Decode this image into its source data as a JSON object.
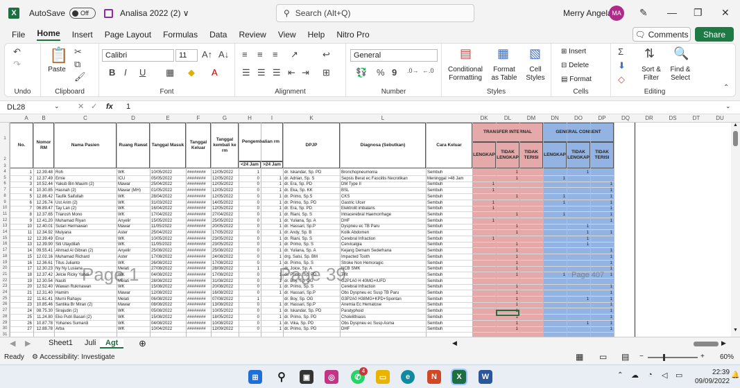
{
  "app": {
    "autosave_label": "AutoSave",
    "toggle_state": "Off",
    "doc_title": "Analisa 2022 (2)",
    "doc_suffix": "∨",
    "search_placeholder": "Search (Alt+Q)",
    "user_name": "Merry Angela",
    "user_initials": "MA"
  },
  "menu": [
    "File",
    "Home",
    "Insert",
    "Page Layout",
    "Formulas",
    "Data",
    "Review",
    "View",
    "Help",
    "Nitro Pro"
  ],
  "menu_active": "Home",
  "actions": {
    "comments": "Comments",
    "share": "Share"
  },
  "ribbon": {
    "undo_label": "Undo",
    "clipboard_label": "Clipboard",
    "paste_label": "Paste",
    "font_label": "Font",
    "font_name": "Calibri",
    "font_size": "11",
    "bold": "B",
    "italic": "I",
    "underline": "U",
    "alignment_label": "Alignment",
    "number_label": "Number",
    "number_format": "General",
    "percent": "%",
    "comma": "9",
    "conditional": "Conditional Formatting",
    "format_table": "Format as Table",
    "cell_styles": "Cell Styles",
    "styles_label": "Styles",
    "insert": "Insert",
    "delete": "Delete",
    "format": "Format",
    "cells_label": "Cells",
    "sort": "Sort & Filter",
    "find": "Find & Select",
    "editing_label": "Editing"
  },
  "formula": {
    "namebox": "DL28",
    "fx": "fx",
    "value": "1"
  },
  "columns_left": [
    "A",
    "B",
    "C",
    "D",
    "E",
    "F",
    "G",
    "H",
    "I",
    "K",
    "L"
  ],
  "columns_right": [
    "DK",
    "DL",
    "DM",
    "DN",
    "DO",
    "DP",
    "DQ",
    "DR",
    "DS",
    "DT",
    "DU"
  ],
  "row_numbers": [
    "1",
    "2",
    "3",
    "4",
    "5",
    "6",
    "7",
    "8",
    "9",
    "10",
    "11",
    "12",
    "13",
    "14",
    "15",
    "16",
    "17",
    "18",
    "19",
    "20",
    "21",
    "22",
    "23",
    "24",
    "25",
    "26",
    "27",
    "28",
    "29",
    "30",
    "31",
    "32"
  ],
  "headers": {
    "no": "No.",
    "rm": "Nomor RM",
    "nama": "Nama Pasien",
    "ruang": "Ruang Rawat",
    "masuk": "Tanggal Masuk",
    "keluar": "Tanggal Keluar",
    "kembali": "Tanggal kembali ke rm",
    "pengembalian": "Pengembalian rm",
    "lt24": "<24 Jam",
    "gt24": ">24 Jam",
    "dpjp": "DPJP",
    "diagnosa": "Diagnosa (Sebutkan)",
    "cara": "Cara Keluar",
    "transfer": "TRANSFER INTERNAL",
    "consent": "GENERAL CONSENT",
    "lengkap": "LENGKAP",
    "tidak_lengkap": "TIDAK LENGKAP",
    "tidak_terisi": "TIDAK TERISI"
  },
  "rows": [
    [
      "1",
      "12.39.48",
      "Roh",
      "WK",
      "10/05/2022",
      "########",
      "12/05/2022",
      "1",
      "",
      "dr. Iskandar, Sp. PD",
      "Bronchopneumonia",
      "Sembuh",
      "",
      "1",
      "",
      "",
      "1",
      ""
    ],
    [
      "2",
      "12.37.49",
      "Ernie",
      "ICU",
      "05/05/2022",
      "########",
      "12/05/2022",
      "0",
      "1",
      "dr. Adrian, Sp. S",
      "Sepsis Berat ec Fasciitis Necrotikan",
      "Meninggal >48 Jam",
      "",
      "1",
      "",
      "1",
      "",
      ""
    ],
    [
      "3",
      "10.52.44",
      "Yakub Bin Mauim (2)",
      "Mawar",
      "25/04/2022",
      "########",
      "12/05/2022",
      "0",
      "1",
      "dr. Era, Sp. PD",
      "DM Type II",
      "Sembuh",
      "1",
      "",
      "",
      "",
      "",
      "1"
    ],
    [
      "4",
      "10.30.85",
      "Hasnah (2)",
      "Mawar (MH)",
      "01/05/2022",
      "########",
      "12/05/2022",
      "0",
      "1",
      "dr. Eka, Sp. KK",
      "BSL",
      "Sembuh",
      "1",
      "",
      "",
      "",
      "",
      "1"
    ],
    [
      "5",
      "12.86.42",
      "Taufik Saifullah",
      "WK",
      "28/04/2022",
      "########",
      "12/05/2022",
      "0",
      "1",
      "dr. Primo, Sp.S",
      "CKS",
      "Sembuh",
      "",
      "1",
      "",
      "1",
      "",
      "1"
    ],
    [
      "6",
      "12.26.74",
      "Ust Arim (2)",
      "WK",
      "31/03/2022",
      "########",
      "14/05/2022",
      "0",
      "1",
      "dr. Primo, Sp. PD",
      "Gastric Ulcer",
      "Sembuh",
      "1",
      "",
      "",
      "1",
      "",
      "1"
    ],
    [
      "7",
      "06.89.47",
      "Tay Lan (2)",
      "WK",
      "16/04/2022",
      "########",
      "12/05/2022",
      "0",
      "1",
      "dr. Era, Sp. PD",
      "Elektrolit imbalans",
      "Sembuh",
      "1",
      "",
      "",
      "",
      "",
      "1"
    ],
    [
      "8",
      "12.37.65",
      "Triarosh Mono",
      "WK",
      "17/04/2022",
      "########",
      "27/04/2022",
      "0",
      "1",
      "dr. Riani, Sp. S",
      "Intracerebral Haemorrhage",
      "Sembuh",
      "",
      "1",
      "",
      "1",
      "",
      "1"
    ],
    [
      "9",
      "12.41.20",
      "Muhamad Riyan",
      "Anyelir",
      "15/05/2022",
      "########",
      "25/05/2022",
      "0",
      "1",
      "dr. Yuliana, Sp. A",
      "DHF",
      "Sembuh",
      "1",
      "",
      "",
      "",
      "",
      "1"
    ],
    [
      "10",
      "12.40.01",
      "Sutari Hermawan",
      "Mawar",
      "11/05/2022",
      "########",
      "20/05/2022",
      "0",
      "1",
      "dr. Hassari, Sp.P",
      "Dyspneu ec TB Paru",
      "Sembuh",
      "",
      "1",
      "",
      "",
      "1",
      ""
    ],
    [
      "11",
      "12.34.92",
      "Mulyana",
      "Aster",
      "25/04/2022",
      "########",
      "17/05/2022",
      "0",
      "1",
      "dr. Andy, Sp. B",
      "Kolik Abdomen",
      "Sembuh",
      "",
      "1",
      "",
      "",
      "1",
      "1"
    ],
    [
      "12",
      "12.39.49",
      "Enur",
      "WK",
      "10/05/2022",
      "########",
      "23/05/2022",
      "0",
      "1",
      "dr. Riani, Sp. S",
      "Cerebral Infraction",
      "Sembuh",
      "1",
      "",
      "",
      "",
      "1",
      ""
    ],
    [
      "13",
      "12.39.90",
      "Siti Utaydilah",
      "WK",
      "11/05/2022",
      "########",
      "23/05/2022",
      "0",
      "1",
      "dr. Primo, Sp. S",
      "Cervicalgia",
      "Sembuh",
      "",
      "1",
      "",
      "",
      "1",
      ""
    ],
    [
      "14",
      "09.55.41",
      "Ahmad Al Gibran (2)",
      "Anyelir",
      "25/08/2022",
      "########",
      "25/08/2022",
      "0",
      "1",
      "dr. Yuliana, Sp. A",
      "Kejang Demam Sederhana",
      "Sembuh",
      "",
      "1",
      "",
      "",
      "",
      "1"
    ],
    [
      "15",
      "12.02.16",
      "Muhamad Richard",
      "Aster",
      "17/08/2022",
      "########",
      "24/08/2022",
      "0",
      "1",
      "drg. Salsi, Sp. BM",
      "Impacted Tooth",
      "Sembuh",
      "",
      "1",
      "",
      "",
      "",
      "1"
    ],
    [
      "16",
      "12.36.61",
      "Titus Julianto",
      "WK",
      "26/08/2022",
      "########",
      "17/08/2022",
      "0",
      "1",
      "dr. Primo, Sp. S",
      "Stroke Non Hemoragic",
      "Sembuh",
      "",
      "1",
      "",
      "",
      "",
      "1"
    ],
    [
      "17",
      "12.30.23",
      "Ny Ny Lusiana",
      "Melati",
      "27/08/2022",
      "########",
      "28/08/2022",
      "1",
      "",
      "dr. Joice, Sp. A",
      "NCB SMK",
      "Sembuh",
      "",
      "1",
      "",
      "",
      "",
      "1"
    ],
    [
      "18",
      "12.37.42",
      "Jelcie Ricky Yahdi",
      "WK",
      "04/08/2022",
      "########",
      "17/08/2022",
      "0",
      "1",
      "dr. Primo, Sp. PD",
      "Tifit",
      "Sembuh",
      "",
      "1",
      "",
      "1",
      "",
      "1"
    ],
    [
      "19",
      "12.30.54",
      "Nasiti",
      "Melati",
      "28/08/2022",
      "########",
      "31/08/2022",
      "0",
      "1",
      "dr. Boy, Sp. OG",
      "G2P1A0 H 40MG+IUFD",
      "Sembuh",
      "",
      "",
      "",
      "",
      "",
      ""
    ],
    [
      "20",
      "12.52.40",
      "Wawan Rukmawan",
      "WK",
      "15/08/2022",
      "########",
      "20/08/2022",
      "0",
      "1",
      "dr. Primo, Sp. S",
      "Cerebral Infraction",
      "Sembuh",
      "",
      "1",
      "",
      "",
      "",
      "1"
    ],
    [
      "21",
      "12.31.40",
      "Hamim",
      "Mawar",
      "12/08/2022",
      "########",
      "16/08/2022",
      "0",
      "1",
      "dr. Hassari, Sp.P",
      "Obs Dyspneu ec Susp TB Paru",
      "Sembuh",
      "",
      "1",
      "",
      "",
      "",
      "1"
    ],
    [
      "22",
      "11.61.41",
      "Murni Rahayu",
      "Melati",
      "06/08/2022",
      "########",
      "07/08/2022",
      "1",
      "",
      "dr. Boy, Sp. OG",
      "G3P2A0 H38MG+KPD+Spontan",
      "Sembuh",
      "",
      "1",
      "",
      "",
      "1",
      "1"
    ],
    [
      "23",
      "10.85.46",
      "Santika Br Miran (2)",
      "Mawar",
      "08/08/2022",
      "########",
      "13/08/2022",
      "0",
      "1",
      "dr. Hassari, Sp.P",
      "Anemia Ec Hematose",
      "Sembuh",
      "",
      "1",
      "",
      "",
      "",
      "1"
    ],
    [
      "24",
      "08.75.30",
      "Sirajudin (2)",
      "WK",
      "05/08/2022",
      "########",
      "10/05/2022",
      "0",
      "1",
      "dr. Iskandar, Sp. PD",
      "Paratyphoid",
      "Sembuh",
      "",
      "1",
      "",
      "",
      "",
      "1"
    ],
    [
      "25",
      "11.24.80",
      "Eko Putri Basari (2)",
      "WK",
      "15/08/2022",
      "########",
      "18/05/2022",
      "0",
      "1",
      "dr. Primo, Sp. PD",
      "Cholelithiasis",
      "Sembuh",
      "",
      "1",
      "",
      "",
      "",
      "1"
    ],
    [
      "26",
      "10.87.78",
      "Yohanes Sumardi",
      "WK",
      "04/08/2022",
      "########",
      "10/08/2022",
      "0",
      "1",
      "dr. Vika, Sp. PD",
      "Obs Dyspneu ec Susp Asma",
      "Sembuh",
      "",
      "1",
      "",
      "",
      "1",
      "1"
    ],
    [
      "27",
      "12.88.78",
      "Arba",
      "WK",
      "10/04/2022",
      "########",
      "12/09/2022",
      "0",
      "1",
      "dr. Primo, Sp. PD",
      "DHF",
      "Sembuh",
      "",
      "1",
      "",
      "",
      "",
      "1"
    ]
  ],
  "watermarks": {
    "w1": "Page 1",
    "w2": "Page 39",
    "w3": "Page 407"
  },
  "sheets": [
    "Sheet1",
    "Juli",
    "Agt"
  ],
  "active_sheet": "Agt",
  "status": {
    "ready": "Ready",
    "accessibility": "Accessibility: Investigate",
    "zoom": "60%"
  },
  "taskbar": {
    "time": "22:39",
    "date": "09/09/2022",
    "badge": "4"
  },
  "colors": {
    "excel_green": "#1d6f42",
    "pink": "#e6a9a9",
    "blue": "#93b4e3",
    "avatar": "#b02a8a"
  }
}
